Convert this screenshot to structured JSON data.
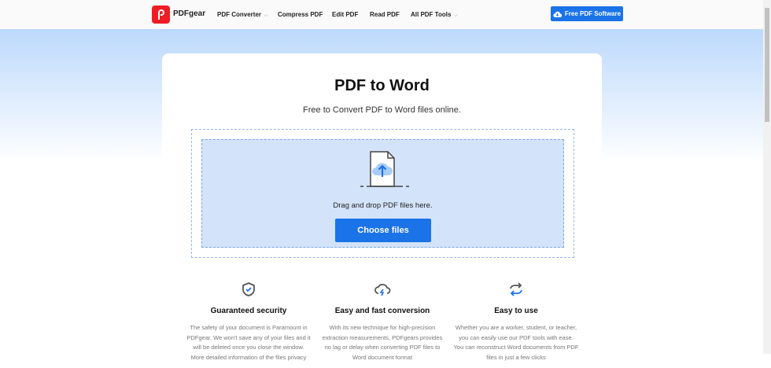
{
  "header": {
    "brand": "PDFgear",
    "nav": [
      {
        "label": "PDF Converter",
        "dropdown": true
      },
      {
        "label": "Compress PDF"
      },
      {
        "label": "Edit PDF"
      },
      {
        "label": "Read PDF"
      },
      {
        "label": "All PDF Tools",
        "dropdown": true
      }
    ],
    "cta": "Free PDF Software"
  },
  "main": {
    "title": "PDF to Word",
    "subtitle": "Free to Convert PDF to Word files online.",
    "drop_text": "Drag and drop PDF files here.",
    "choose": "Choose files"
  },
  "features": [
    {
      "icon": "shield-check-icon",
      "title": "Guaranteed security",
      "text": "The safety of your document is Paramount in PDFgear. We won't save any of your files and it will be deleted once you close the window. More detailed information of the files privacy"
    },
    {
      "icon": "cloud-lightning-icon",
      "title": "Easy and fast conversion",
      "text": "With its new technique for high-precision extraction measurements, PDFgears provides no lag or delay when converting PDF files to Word document format"
    },
    {
      "icon": "refresh-arrows-icon",
      "title": "Easy to use",
      "text": "Whether you are a worker, student, or teacher, you can easily use our PDF tools with ease. You can reconstruct Word documents from PDF files in just a few clicks"
    }
  ],
  "colors": {
    "accent": "#1b73e8",
    "brand": "#ee1c25"
  }
}
